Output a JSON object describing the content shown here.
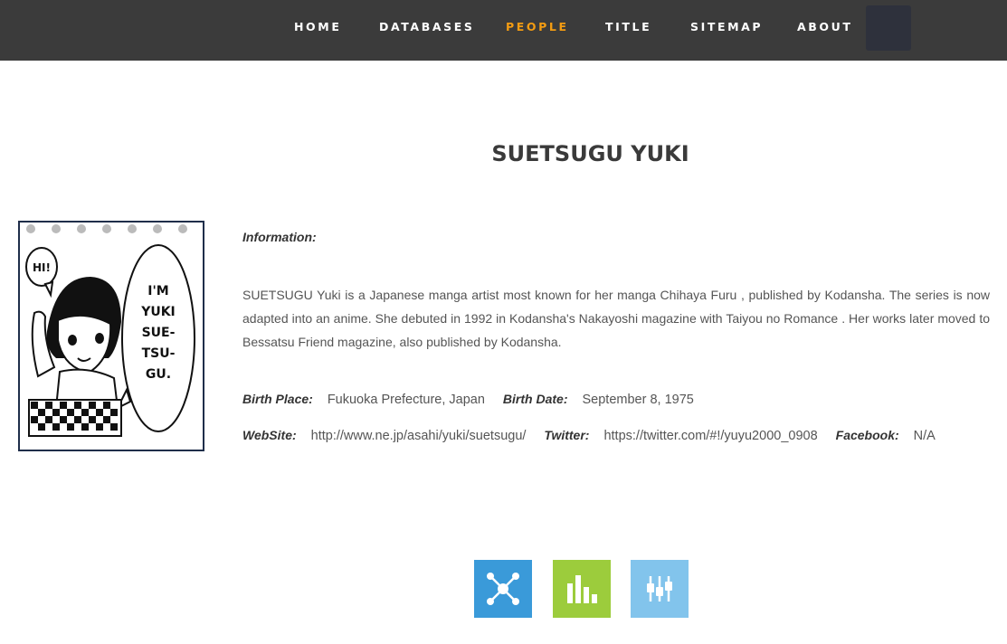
{
  "nav": {
    "items": [
      {
        "label": "HOME",
        "active": false
      },
      {
        "label": "DATABASES",
        "active": false
      },
      {
        "label": "PEOPLE",
        "active": true
      },
      {
        "label": "TITLE",
        "active": false
      },
      {
        "label": "SITEMAP",
        "active": false
      },
      {
        "label": "ABOUT",
        "active": false
      }
    ],
    "active_color": "#f39c12"
  },
  "person": {
    "name": "SUETSUGU YUKI",
    "portrait": {
      "speech_left": "HI!",
      "speech_right_lines": [
        "I'M",
        "YUKI",
        "SUE-",
        "TSU-",
        "GU."
      ]
    },
    "info_label": "Information:",
    "description": "SUETSUGU Yuki is a Japanese manga artist most known for her manga Chihaya Furu , published by Kodansha. The series is now adapted into an anime. She debuted in 1992 in Kodansha's Nakayoshi magazine with Taiyou no Romance . Her works later moved to Bessatsu Friend magazine, also published by Kodansha.",
    "birth_place_label": "Birth Place:",
    "birth_place": "Fukuoka Prefecture, Japan",
    "birth_date_label": "Birth Date:",
    "birth_date": "September 8, 1975",
    "website_label": "WebSite:",
    "website": "http://www.ne.jp/asahi/yuki/suetsugu/",
    "twitter_label": "Twitter:",
    "twitter": "https://twitter.com/#!/yuyu2000_0908",
    "facebook_label": "Facebook:",
    "facebook": "N/A"
  },
  "tiles": [
    {
      "icon": "network-icon",
      "color": "#3a9ad9"
    },
    {
      "icon": "bar-chart-icon",
      "color": "#9ccc3c"
    },
    {
      "icon": "equalizer-icon",
      "color": "#82c4ec"
    }
  ]
}
